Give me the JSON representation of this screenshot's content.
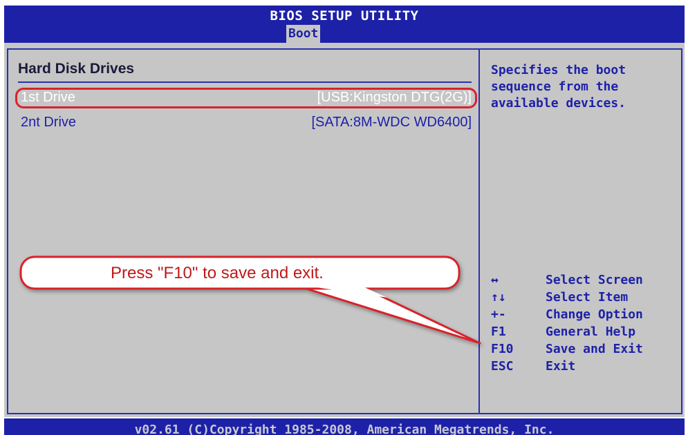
{
  "header": {
    "title": "BIOS SETUP UTILITY",
    "active_tab": "Boot"
  },
  "main": {
    "section_title": "Hard Disk Drives",
    "drives": [
      {
        "label": "1st Drive",
        "value": "[USB:Kingston DTG(2G)]",
        "selected": true
      },
      {
        "label": "2nt Drive",
        "value": "[SATA:8M-WDC WD6400]",
        "selected": false
      }
    ]
  },
  "help": {
    "text": "Specifies the boot sequence from the available devices."
  },
  "keys": [
    {
      "key": "↔",
      "icon": "left-right-arrow-icon",
      "desc": "Select Screen"
    },
    {
      "key": "↑↓",
      "icon": "up-down-arrow-icon",
      "desc": "Select Item"
    },
    {
      "key": "+-",
      "icon": "plus-minus-icon",
      "desc": "Change Option"
    },
    {
      "key": "F1",
      "desc": "General Help"
    },
    {
      "key": "F10",
      "desc": "Save and Exit"
    },
    {
      "key": "ESC",
      "desc": "Exit"
    }
  ],
  "callout": {
    "text": "Press \"F10\" to save and exit."
  },
  "footer": {
    "copyright": "v02.61 (C)Copyright 1985-2008, American Megatrends, Inc."
  },
  "colors": {
    "bios_blue": "#1d21a8",
    "bios_gray": "#c6c6c6",
    "highlight_red": "#d8232a"
  }
}
